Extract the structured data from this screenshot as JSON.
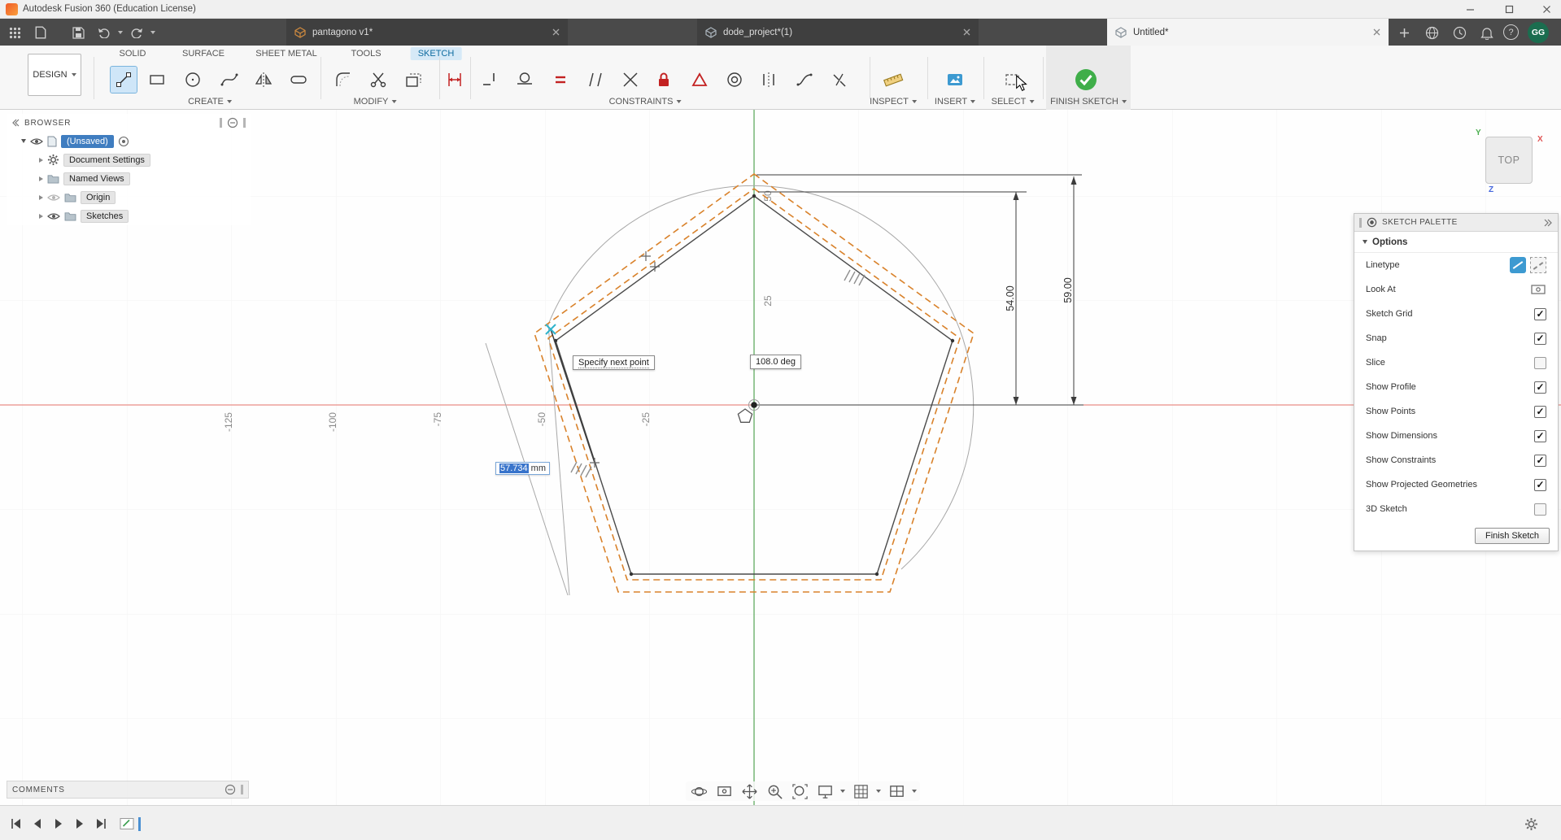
{
  "titlebar": {
    "title": "Autodesk Fusion 360 (Education License)"
  },
  "tabbar": {
    "tabs": [
      {
        "label": "pantagono v1*"
      },
      {
        "label": "dode_project*(1)"
      },
      {
        "label": "Untitled*"
      }
    ],
    "help": "?",
    "avatar": "GG"
  },
  "ribbon": {
    "design": "DESIGN",
    "tabs": [
      "SOLID",
      "SURFACE",
      "SHEET METAL",
      "TOOLS",
      "SKETCH"
    ],
    "groups": {
      "create": "CREATE",
      "modify": "MODIFY",
      "constraints": "CONSTRAINTS",
      "inspect": "INSPECT",
      "insert": "INSERT",
      "select": "SELECT",
      "finish": "FINISH SKETCH"
    }
  },
  "browser": {
    "title": "BROWSER",
    "root": "(Unsaved)",
    "items": [
      {
        "label": "Document Settings"
      },
      {
        "label": "Named Views"
      },
      {
        "label": "Origin"
      },
      {
        "label": "Sketches"
      }
    ]
  },
  "canvas": {
    "tooltip": "Specify next point",
    "angle": "108.0 deg",
    "length": "57.734",
    "unit": "mm",
    "dim_right_outer": "59.00",
    "dim_right_inner": "54.00",
    "x_labels": [
      "-125",
      "-100",
      "-75",
      "-50",
      "-25"
    ],
    "y_labels": [
      "50",
      "25"
    ],
    "viewcube": {
      "face": "TOP",
      "x": "X",
      "y": "Y",
      "z": "Z"
    }
  },
  "palette": {
    "title": "SKETCH PALETTE",
    "section": "Options",
    "rows": [
      {
        "label": "Linetype",
        "control": "linetype"
      },
      {
        "label": "Look At",
        "control": "lookat"
      },
      {
        "label": "Sketch Grid",
        "control": "checkbox",
        "checked": true
      },
      {
        "label": "Snap",
        "control": "checkbox",
        "checked": true
      },
      {
        "label": "Slice",
        "control": "checkbox",
        "checked": false
      },
      {
        "label": "Show Profile",
        "control": "checkbox",
        "checked": true
      },
      {
        "label": "Show Points",
        "control": "checkbox",
        "checked": true
      },
      {
        "label": "Show Dimensions",
        "control": "checkbox",
        "checked": true
      },
      {
        "label": "Show Constraints",
        "control": "checkbox",
        "checked": true
      },
      {
        "label": "Show Projected Geometries",
        "control": "checkbox",
        "checked": true
      },
      {
        "label": "3D Sketch",
        "control": "checkbox",
        "checked": false
      }
    ],
    "finish": "Finish Sketch"
  },
  "comments": {
    "title": "COMMENTS"
  },
  "colors": {
    "accent": "#0696d7",
    "projected_geometry": "#d9822b",
    "axis_x": "#e4736b",
    "axis_y": "#55a455",
    "selection": "#3874cb"
  }
}
